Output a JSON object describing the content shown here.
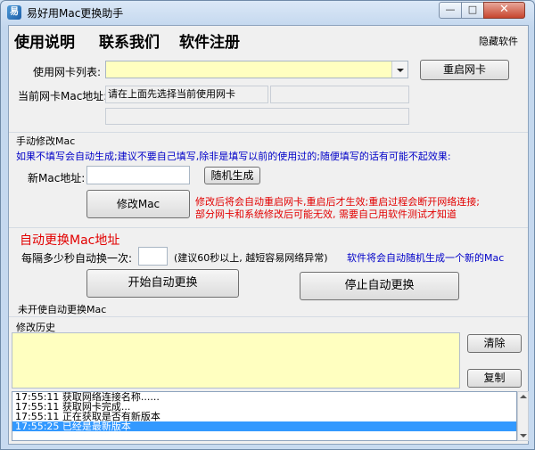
{
  "window": {
    "title": "易好用Mac更换助手",
    "icon_glyph": "易",
    "minimize_glyph": "—",
    "maximize_glyph": "□",
    "close_glyph": "✕"
  },
  "menu": {
    "items": [
      "使用说明",
      "联系我们",
      "软件注册"
    ],
    "hide_link": "隐藏软件"
  },
  "adapter": {
    "list_label": "使用网卡列表:",
    "list_value": "",
    "restart_button": "重启网卡",
    "current_mac_label": "当前网卡Mac地址:",
    "current_mac_value": "请在上面先选择当前使用网卡",
    "combo_highlight_color": "#ffffc0"
  },
  "manual": {
    "group_title": "手动修改Mac",
    "hint": "如果不填写会自动生成;建议不要自己填写,除非是填写以前的使用过的;随便填写的话有可能不起效果:",
    "new_mac_label": "新Mac地址:",
    "new_mac_value": "",
    "random_button": "随机生成",
    "modify_button": "修改Mac",
    "warning_line1": "修改后将会自动重启网卡,重启后才生效;重启过程会断开网络连接;",
    "warning_line2": "部分网卡和系统修改后可能无效, 需要自己用软件测试才知道"
  },
  "auto": {
    "title": "自动更换Mac地址",
    "interval_label": "每隔多少秒自动换一次:",
    "interval_value": "",
    "interval_note": "(建议60秒以上, 越短容易网络异常)",
    "auto_note": "软件将会自动随机生成一个新的Mac",
    "start_button": "开始自动更换",
    "stop_button": "停止自动更换",
    "status": "未开使自动更换Mac"
  },
  "history": {
    "title": "修改历史",
    "clear_button": "清除",
    "copy_button": "复制",
    "background_color": "#ffffc0"
  },
  "log": {
    "lines": [
      {
        "time": "17:55:11",
        "text": "获取网络连接名称......"
      },
      {
        "time": "17:55:11",
        "text": "获取网卡完成..."
      },
      {
        "time": "17:55:11",
        "text": "正在获取是否有新版本"
      },
      {
        "time": "17:55:25",
        "text": "已经是最新版本"
      }
    ],
    "selection_color": "#3399ff"
  },
  "colors": {
    "warning": "#e20000",
    "info": "#0000c8"
  }
}
